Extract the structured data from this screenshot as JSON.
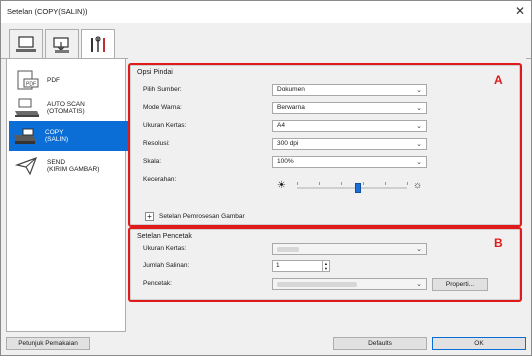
{
  "window": {
    "title": "Setelan (COPY(SALIN))"
  },
  "tabs": [
    {
      "icon": "computer-scan-icon"
    },
    {
      "icon": "scanner-tray-icon"
    },
    {
      "icon": "tools-icon"
    }
  ],
  "sidebar": {
    "items": [
      {
        "icon": "pdf-icon",
        "label": "PDF"
      },
      {
        "icon": "auto-scan-icon",
        "label": "AUTO SCAN\n(OTOMATIS)"
      },
      {
        "icon": "copy-icon",
        "label": "COPY\n(SALIN)",
        "selected": true
      },
      {
        "icon": "send-icon",
        "label": "SEND\n(KIRIM GAMBAR)"
      }
    ]
  },
  "scan_options": {
    "title": "Opsi Pindai",
    "marker": "A",
    "source_label": "Pilih Sumber:",
    "source_value": "Dokumen",
    "color_label": "Mode Warna:",
    "color_value": "Berwarna",
    "paper_label": "Ukuran Kertas:",
    "paper_value": "A4",
    "resolution_label": "Resolusi:",
    "resolution_value": "300 dpi",
    "scale_label": "Skala:",
    "scale_value": "100%",
    "brightness_label": "Kecerahan:",
    "brightness_level": 0.55,
    "image_processing_label": "Setelan Pemrosesan Gambar",
    "expand_symbol": "+"
  },
  "printer_settings": {
    "title": "Setelan Pencetak",
    "marker": "B",
    "paper_label": "Ukuran Kertas:",
    "copies_label": "Jumlah Salinan:",
    "copies_value": "1",
    "printer_label": "Pencetak:",
    "properties_button": "Properti..."
  },
  "footer": {
    "help_button": "Petunjuk Pemakaian",
    "defaults_button": "Defaults",
    "ok_button": "OK"
  },
  "colors": {
    "highlight": "#e01a1a",
    "selection": "#0a6ed6"
  }
}
